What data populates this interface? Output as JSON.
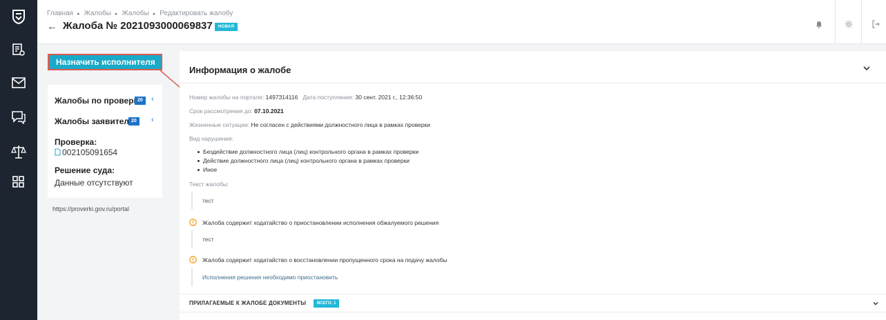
{
  "breadcrumb": [
    "Главная",
    "Жалобы",
    "Жалобы",
    "Редактировать жалобу"
  ],
  "header": {
    "back_icon": "arrow-left-icon",
    "title": "Жалоба № 2021093000069837",
    "status": "НОВАЯ"
  },
  "topbar_icons": [
    "bell-icon",
    "gear-icon",
    "logout-icon"
  ],
  "rail_icons": [
    "coat-of-arms-logo",
    "document-search-icon",
    "mail-icon",
    "chat-icon",
    "scales-icon",
    "grid-icon"
  ],
  "assign_button": "Назначить исполнителя",
  "side": {
    "inspection_complaints": {
      "label": "Жалобы по проверке",
      "count": "20"
    },
    "applicant_complaints": {
      "label": "Жалобы заявителя",
      "count": "20"
    },
    "inspection_label": "Проверка:",
    "inspection_value": "002105091654",
    "court_label": "Решение суда:",
    "court_value": "Данные отсутствуют"
  },
  "portal_link": "https://proverki.gov.ru/portal",
  "info": {
    "title": "Информация о жалобе",
    "portal_number_label": "Номер жалобы на портале:",
    "portal_number": "1497314116",
    "received_label": "Дата поступления:",
    "received": "30 сент. 2021 г., 12:36:50",
    "deadline_label": "Срок рассмотрения до:",
    "deadline": "07.10.2021",
    "life_label": "Жизненные ситуации:",
    "life_value": "Не согласен с действиями должностного лица в рамках проверки",
    "violation_label": "Вид нарушения:",
    "violations": [
      "Бездействие должностного лица (лиц) контрольного органа в рамках проверки",
      "Действие должностного лица (лиц) контрольного органа в рамках проверки",
      "Иное"
    ],
    "text_label": "Текст жалобы:",
    "text_value": "тест",
    "suspend_notice": "Жалоба содержит ходатайство о приостановлении исполнения обжалуемого решения",
    "suspend_text": "тест",
    "restore_notice": "Жалоба содержит ходатайство о восстановлении пропущенного срока на подачу жалобы",
    "restore_text": "Исполнения решения необходимо приостановить"
  },
  "documents": {
    "title": "ПРИЛАГАЕМЫЕ К ЖАЛОБЕ ДОКУМЕНТЫ",
    "badge": "ВСЕГО: 1"
  },
  "colors": {
    "rail": "#1d2531",
    "accent": "#1aa9c8",
    "badge": "#21b8d8",
    "count": "#1a73c9",
    "warn": "#f0a020",
    "annotation": "#e05a4e"
  }
}
